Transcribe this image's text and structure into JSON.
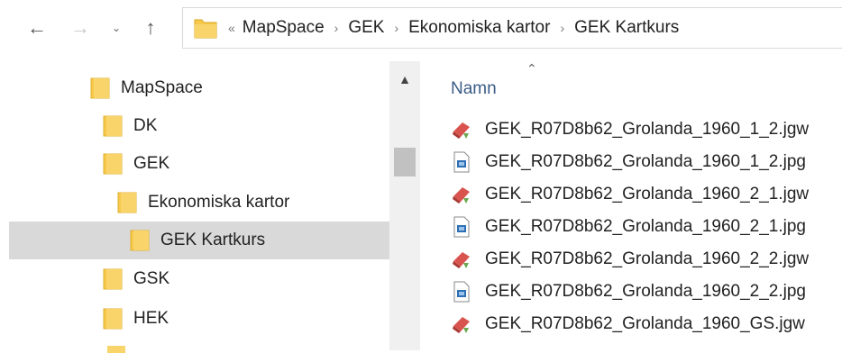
{
  "nav": {
    "back_icon": "arrow-left-icon",
    "forward_icon": "arrow-right-icon",
    "recent_icon": "chevron-down-icon",
    "up_icon": "arrow-up-icon"
  },
  "address": {
    "overflow": "«",
    "separator": "›",
    "crumbs": [
      "MapSpace",
      "GEK",
      "Ekonomiska kartor",
      "GEK Kartkurs"
    ]
  },
  "tree": {
    "items": [
      {
        "label": "MapSpace"
      },
      {
        "label": "DK"
      },
      {
        "label": "GEK"
      },
      {
        "label": "Ekonomiska kartor"
      },
      {
        "label": "GEK Kartkurs",
        "selected": true
      },
      {
        "label": "GSK"
      },
      {
        "label": "HEK"
      }
    ]
  },
  "files": {
    "column_header": "Namn",
    "sort_icon": "sort-ascending-icon",
    "items": [
      {
        "name": "GEK_R07D8b62_Grolanda_1960_1_2.jgw",
        "icon": "jgw-file-icon"
      },
      {
        "name": "GEK_R07D8b62_Grolanda_1960_1_2.jpg",
        "icon": "jpg-file-icon"
      },
      {
        "name": "GEK_R07D8b62_Grolanda_1960_2_1.jgw",
        "icon": "jgw-file-icon"
      },
      {
        "name": "GEK_R07D8b62_Grolanda_1960_2_1.jpg",
        "icon": "jpg-file-icon"
      },
      {
        "name": "GEK_R07D8b62_Grolanda_1960_2_2.jgw",
        "icon": "jgw-file-icon"
      },
      {
        "name": "GEK_R07D8b62_Grolanda_1960_2_2.jpg",
        "icon": "jpg-file-icon"
      },
      {
        "name": "GEK_R07D8b62_Grolanda_1960_GS.jgw",
        "icon": "jgw-file-icon"
      }
    ]
  },
  "colors": {
    "folder": "#f6c94a",
    "selection": "#d9d9d9",
    "header_text": "#3a5c87"
  }
}
